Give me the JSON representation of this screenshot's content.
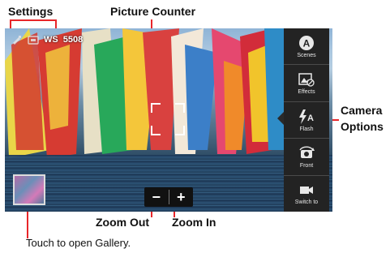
{
  "callouts": {
    "settings": "Settings",
    "picture_counter": "Picture Counter",
    "camera_options_line1": "Camera",
    "camera_options_line2": "Options",
    "zoom_out": "Zoom Out",
    "zoom_in": "Zoom In",
    "gallery": "Touch to open Gallery."
  },
  "viewfinder": {
    "counter": "5508",
    "counter_prefix": "WS"
  },
  "zoom": {
    "out_label": "−",
    "in_label": "+"
  },
  "camera_options": [
    {
      "label": "Scenes",
      "icon": "scenes-icon"
    },
    {
      "label": "Effects",
      "icon": "effects-icon"
    },
    {
      "label": "Flash",
      "icon": "flash-icon"
    },
    {
      "label": "Front",
      "icon": "front-camera-icon"
    },
    {
      "label": "Switch to",
      "icon": "video-camera-icon"
    }
  ],
  "colors": {
    "callout_line": "#e8262a",
    "panel_bg": "#232323"
  }
}
